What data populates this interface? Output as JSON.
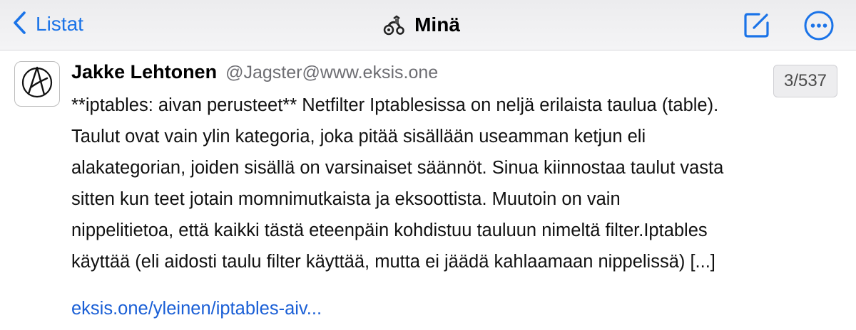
{
  "navbar": {
    "back_label": "Listat",
    "title": "Minä",
    "icons": {
      "back": "chevron-left-icon",
      "avatar": "scooter-avatar-icon",
      "compose": "compose-icon",
      "more": "more-ellipsis-icon"
    },
    "accent_color": "#1a73e8"
  },
  "post": {
    "author_name": "Jakke Lehtonen",
    "author_handle": "@Jagster@www.eksis.one",
    "avatar_icon": "anarchy-a-logo-icon",
    "counter": "3/537",
    "text_lines": [
      "**iptables: aivan perusteet** Netfilter Iptablesissa on neljä erilaista taulua (table).",
      "Taulut ovat vain ylin kategoria, joka pitää sisällään useamman ketjun eli",
      "alakategorian, joiden sisällä on varsinaiset säännöt. Sinua kiinnostaa taulut vasta",
      "sitten kun teet jotain momnimutkaista ja eksoottista. Muutoin on vain",
      "nippelitietoa, että kaikki tästä eteenpäin kohdistuu tauluun nimeltä filter.Iptables",
      "käyttää (eli aidosti taulu filter käyttää, mutta ei jäädä kahlaamaan nippelissä) [...]"
    ],
    "link_text": "eksis.one/yleinen/iptables-aiv...",
    "link_color": "#1a5fd6"
  }
}
